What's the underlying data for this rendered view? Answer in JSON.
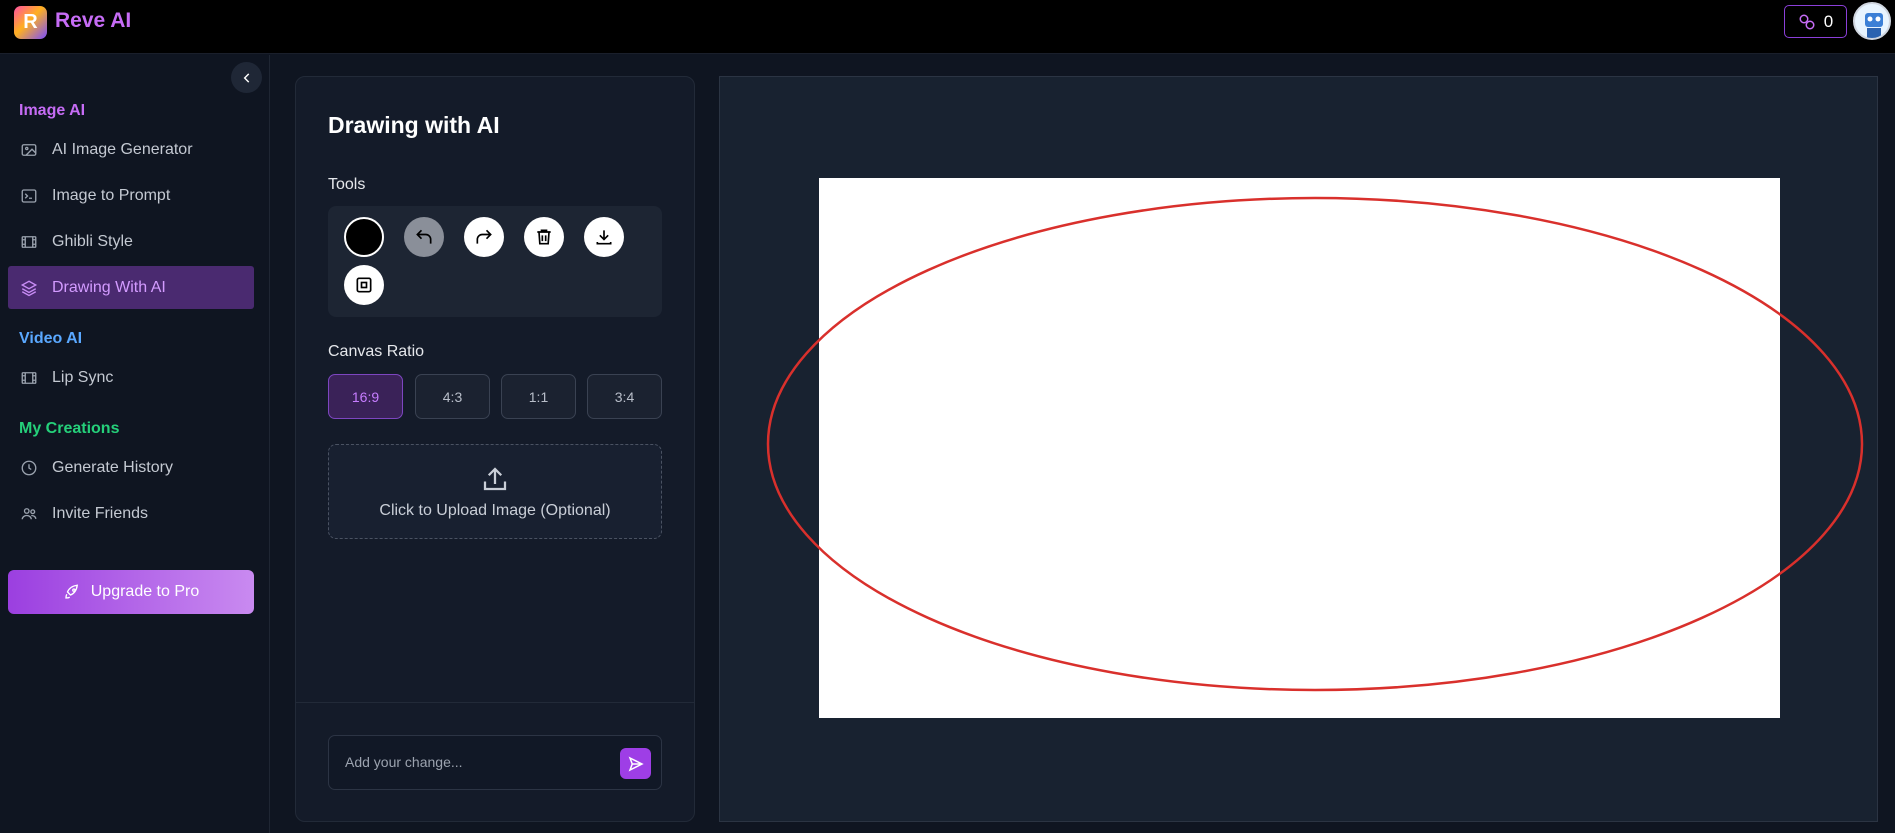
{
  "header": {
    "logo_letter": "R",
    "brand": "Reve AI",
    "credits": "0"
  },
  "sidebar": {
    "sections": [
      {
        "title": "Image AI",
        "color": "#c66cf5"
      },
      {
        "title": "Video AI",
        "color": "#5aa8ff"
      },
      {
        "title": "My Creations",
        "color": "#25d07a"
      }
    ],
    "items": [
      {
        "label": "AI Image Generator",
        "icon": "image-icon"
      },
      {
        "label": "Image to Prompt",
        "icon": "terminal-icon"
      },
      {
        "label": "Ghibli Style",
        "icon": "film-icon"
      },
      {
        "label": "Drawing With AI",
        "icon": "layers-icon",
        "active": true
      },
      {
        "label": "Lip Sync",
        "icon": "film-icon"
      },
      {
        "label": "Generate History",
        "icon": "clock-icon"
      },
      {
        "label": "Invite Friends",
        "icon": "users-icon"
      }
    ],
    "upgrade_label": "Upgrade to Pro"
  },
  "panel": {
    "title": "Drawing with AI",
    "tools_label": "Tools",
    "tools": [
      "color-picker",
      "undo-icon",
      "redo-icon",
      "trash-icon",
      "download-icon",
      "select-icon"
    ],
    "canvas_ratio_label": "Canvas Ratio",
    "ratios": [
      "16:9",
      "4:3",
      "1:1",
      "3:4"
    ],
    "selected_ratio": "16:9",
    "upload_label": "Click to Upload Image (Optional)",
    "prompt_placeholder": "Add your change..."
  },
  "canvas": {
    "stroke_color": "#d9302c",
    "shape": "ellipse"
  },
  "colors": {
    "accent": "#9e3ee6",
    "active_bg": "#4a2a70"
  }
}
